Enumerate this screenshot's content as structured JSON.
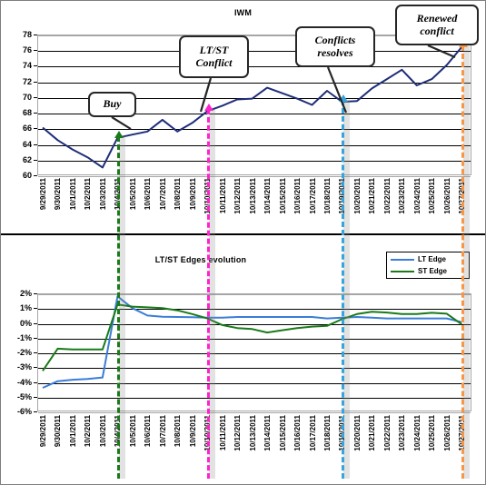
{
  "figure": {
    "border_color": "#7f7f7f",
    "background": "#ffffff"
  },
  "chart_data": [
    {
      "type": "line",
      "id": "iwm-price",
      "title": "IWM",
      "xlabel": "",
      "ylabel": "",
      "ylim": [
        60,
        78
      ],
      "yticks": [
        "60",
        "62",
        "64",
        "66",
        "68",
        "70",
        "72",
        "74",
        "76",
        "78"
      ],
      "grid": true,
      "legend": "none",
      "categories": [
        "9/29/2011",
        "9/30/2011",
        "10/1/2011",
        "10/2/2011",
        "10/3/2011",
        "10/4/2011",
        "10/5/2011",
        "10/6/2011",
        "10/7/2011",
        "10/8/2011",
        "10/9/2011",
        "10/10/2011",
        "10/11/2011",
        "10/12/2011",
        "10/13/2011",
        "10/14/2011",
        "10/15/2011",
        "10/16/2011",
        "10/17/2011",
        "10/18/2011",
        "10/19/2011",
        "10/20/2011",
        "10/21/2011",
        "10/22/2011",
        "10/23/2011",
        "10/24/2011",
        "10/25/2011",
        "10/26/2011",
        "10/27/2011"
      ],
      "series": [
        {
          "name": "IWM",
          "color": "#1f2e79",
          "values": [
            66.1,
            64.5,
            63.3,
            62.3,
            61.0,
            64.8,
            65.2,
            65.6,
            67.1,
            65.6,
            66.7,
            68.2,
            68.9,
            69.7,
            69.8,
            71.2,
            70.5,
            69.8,
            69.0,
            70.8,
            69.4,
            69.5,
            71.1,
            72.3,
            73.5,
            71.5,
            72.3,
            74.1,
            76.4
          ]
        }
      ]
    },
    {
      "type": "line",
      "id": "ltst-edges",
      "title": "LT/ST Edges evolution",
      "xlabel": "",
      "ylabel": "",
      "ylim": [
        -6,
        2
      ],
      "yticks": [
        "2%",
        "1%",
        "0%",
        "-1%",
        "-2%",
        "-3%",
        "-4%",
        "-5%",
        "-6%"
      ],
      "grid": true,
      "legend": "top-right",
      "categories": [
        "9/29/2011",
        "9/30/2011",
        "10/1/2011",
        "10/2/2011",
        "10/3/2011",
        "10/4/2011",
        "10/5/2011",
        "10/6/2011",
        "10/7/2011",
        "10/8/2011",
        "10/9/2011",
        "10/10/2011",
        "10/11/2011",
        "10/12/2011",
        "10/13/2011",
        "10/14/2011",
        "10/15/2011",
        "10/16/2011",
        "10/17/2011",
        "10/18/2011",
        "10/19/2011",
        "10/20/2011",
        "10/21/2011",
        "10/22/2011",
        "10/23/2011",
        "10/24/2011",
        "10/25/2011",
        "10/26/2011",
        "10/27/2011"
      ],
      "series": [
        {
          "name": "LT Edge",
          "color": "#3a7dd8",
          "values": [
            -4.4,
            -3.95,
            -3.85,
            -3.8,
            -3.7,
            1.8,
            1.0,
            0.5,
            0.42,
            0.4,
            0.38,
            0.35,
            0.35,
            0.4,
            0.4,
            0.4,
            0.4,
            0.4,
            0.4,
            0.3,
            0.35,
            0.4,
            0.35,
            0.3,
            0.3,
            0.3,
            0.3,
            0.3,
            0.05
          ]
        },
        {
          "name": "ST Edge",
          "color": "#1a7a1a",
          "values": [
            -3.25,
            -1.75,
            -1.8,
            -1.8,
            -1.8,
            1.25,
            1.1,
            1.05,
            1.0,
            0.85,
            0.6,
            0.3,
            -0.15,
            -0.35,
            -0.42,
            -0.65,
            -0.5,
            -0.35,
            -0.25,
            -0.2,
            0.25,
            0.6,
            0.75,
            0.7,
            0.6,
            0.6,
            0.68,
            0.62,
            -0.1
          ]
        }
      ]
    }
  ],
  "annotations": {
    "buy": {
      "label": "Buy",
      "color": "#1a7a1a",
      "at": "10/4/2011"
    },
    "lt_st_conflict": {
      "label": "LT/ST\nConflict",
      "line1": "LT/ST",
      "line2": "Conflict",
      "color": "#ff22cc",
      "at": "10/10/2011"
    },
    "conflicts_resolves": {
      "label": "Conflicts resolves",
      "line1": "Conflicts",
      "line2": "resolves",
      "color": "#38a4d9",
      "at": "10/19/2011"
    },
    "renewed_conflict": {
      "label": "Renewed conflict",
      "line1": "Renewed",
      "line2": "conflict",
      "color": "#f79646",
      "at": "10/27/2011"
    }
  },
  "legend": {
    "items": [
      {
        "label": "LT Edge",
        "color": "#3a7dd8"
      },
      {
        "label": "ST Edge",
        "color": "#1a7a1a"
      }
    ]
  }
}
